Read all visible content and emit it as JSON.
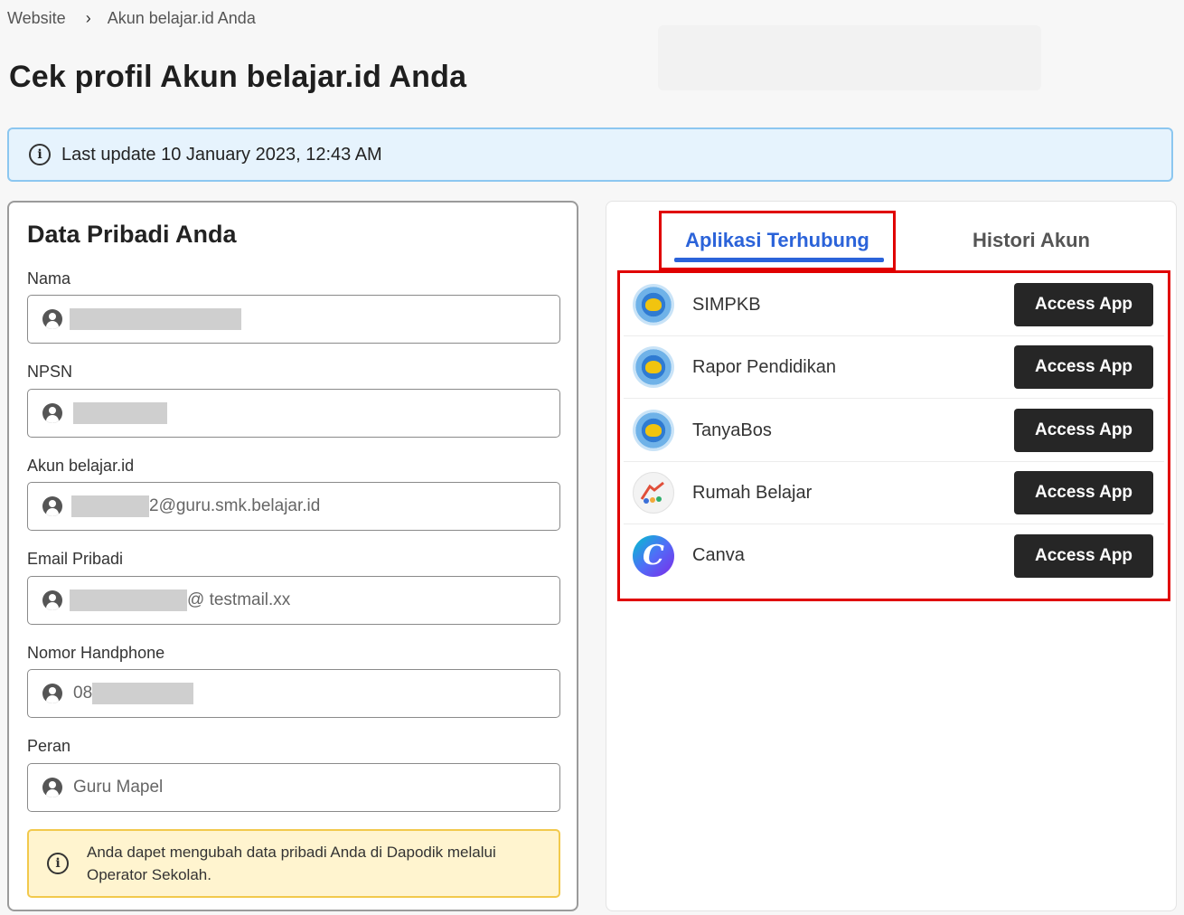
{
  "breadcrumb": {
    "root": "Website",
    "separator": "›",
    "current": "Akun belajar.id Anda"
  },
  "page_title": "Cek profil Akun belajar.id Anda",
  "update_banner": {
    "text": "Last update 10 January 2023, 12:43 AM"
  },
  "personal_data": {
    "title": "Data Pribadi Anda",
    "fields": [
      {
        "label": "Nama",
        "value": ""
      },
      {
        "label": "NPSN",
        "value": ""
      },
      {
        "label": "Akun belajar.id",
        "value": "2@guru.smk.belajar.id"
      },
      {
        "label": "Email Pribadi",
        "value": "@ testmail.xx"
      },
      {
        "label": "Nomor Handphone",
        "value": "08"
      },
      {
        "label": "Peran",
        "value": "Guru Mapel"
      }
    ],
    "notice": "Anda dapet mengubah data pribadi Anda di Dapodik melalui Operator Sekolah."
  },
  "tabs": [
    {
      "label": "Aplikasi Terhubung",
      "active": true
    },
    {
      "label": "Histori Akun",
      "active": false
    }
  ],
  "apps": [
    {
      "name": "SIMPKB",
      "icon": "tut-wuri-logo-icon",
      "button": "Access App"
    },
    {
      "name": "Rapor Pendidikan",
      "icon": "tut-wuri-logo-icon",
      "button": "Access App"
    },
    {
      "name": "TanyaBos",
      "icon": "tut-wuri-logo-icon",
      "button": "Access App"
    },
    {
      "name": "Rumah Belajar",
      "icon": "rumah-belajar-logo-icon",
      "button": "Access App"
    },
    {
      "name": "Canva",
      "icon": "canva-logo-icon",
      "button": "Access App"
    }
  ],
  "colors": {
    "accent": "#2b63d9",
    "highlight": "#e00000",
    "button": "#262626",
    "banner": "#e6f3fd",
    "notice": "#fff4cf"
  }
}
